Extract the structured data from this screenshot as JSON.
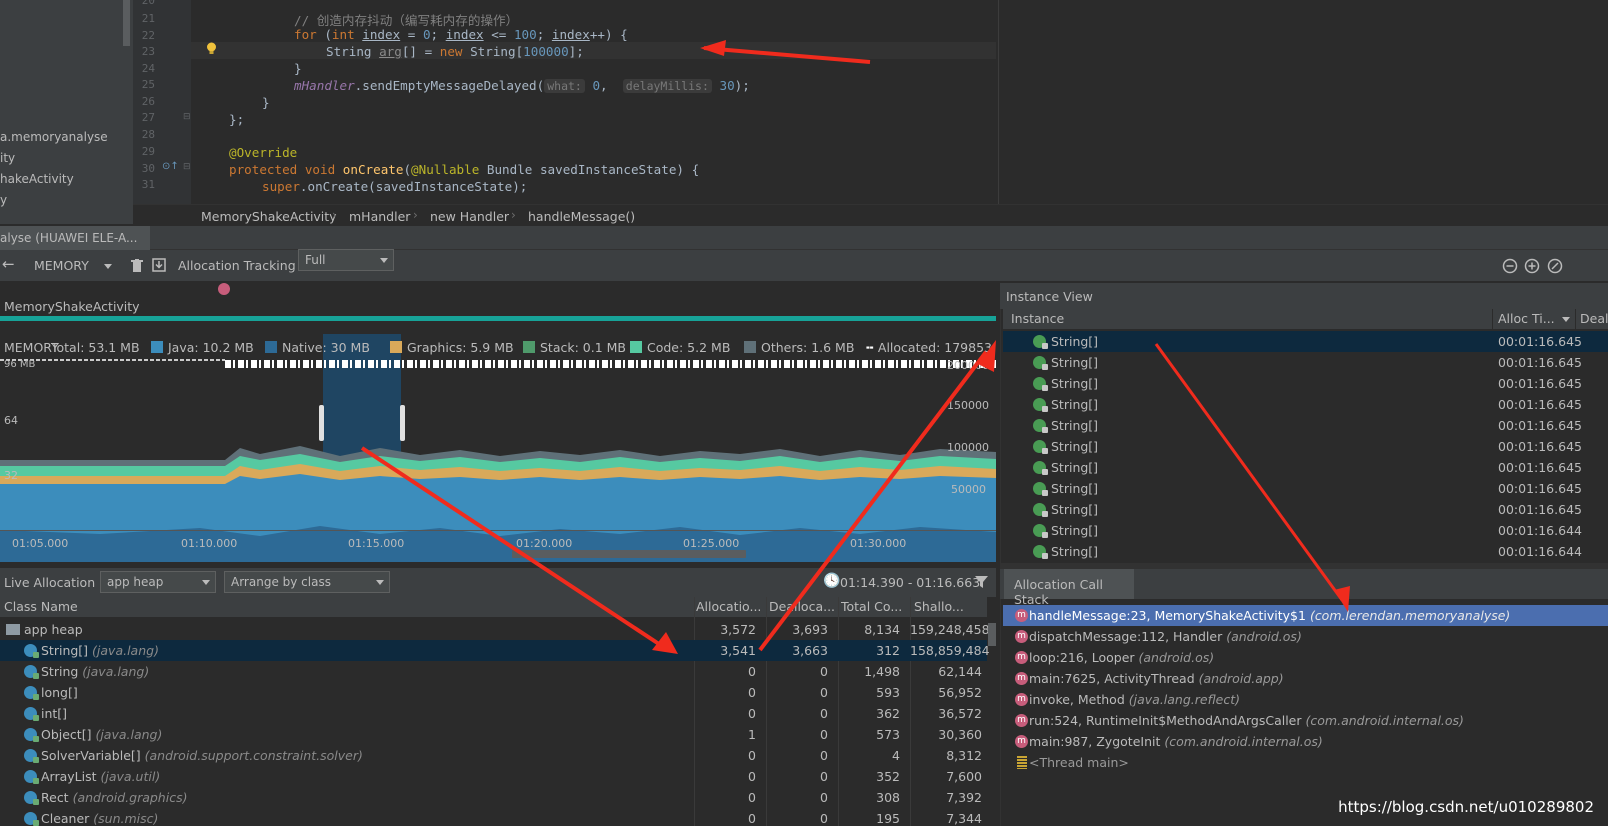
{
  "project_tree": {
    "items": [
      "a.memoryanalyse",
      "ity",
      "hakeActivity",
      "y"
    ]
  },
  "editor": {
    "line_numbers": [
      "20",
      "21",
      "22",
      "23",
      "24",
      "25",
      "26",
      "27",
      "28",
      "29",
      "30",
      "31"
    ],
    "comment_line": "// 创造内存抖动（编写耗内存的操作）",
    "for_kw": "for",
    "for_int": "int",
    "for_index": "index",
    "for_eq": " = ",
    "for_zero": "0",
    "for_cond_index": "index",
    "for_le": " <= ",
    "for_100": "100",
    "for_inc_index": "index",
    "for_tail": "++) {",
    "str_type": "String ",
    "str_var": "arg",
    "str_mid": "[] = ",
    "str_new": "new",
    "str_ctor": " String[",
    "str_size": "100000",
    "str_end": "];",
    "close_brace": "}",
    "handler_field": "mHandler",
    "handler_call": ".sendEmptyMessageDelayed(",
    "hint_what": "what:",
    "arg_what": "0",
    "hint_delay": "delayMillis:",
    "arg_delay": "30",
    "call_end": ");",
    "inner_close": "}",
    "outer_close": "};",
    "override": "@Override",
    "protected_kw": "protected",
    "void_kw": "void",
    "method_name": "onCreate",
    "nullable": "@Nullable",
    "param": " Bundle savedInstanceState) {",
    "super_kw": "super",
    "super_call": ".onCreate(savedInstanceState);"
  },
  "breadcrumb": [
    "MemoryShakeActivity",
    "mHandler",
    "new Handler",
    "handleMessage()"
  ],
  "tool_window": {
    "tab_label": "alyse (HUAWEI ELE-A..."
  },
  "profiler_bar": {
    "section": "MEMORY",
    "allocation_tracking_label": "Allocation Tracking",
    "allocation_tracking_value": "Full"
  },
  "timeline": {
    "activity_label": "MemoryShakeActivity",
    "legend": {
      "memory": "MEMORY",
      "total": "Total: 53.1 MB",
      "java": "Java: 10.2 MB",
      "native": "Native: 30 MB",
      "graphics": "Graphics: 5.9 MB",
      "stack": "Stack: 0.1 MB",
      "code": "Code: 5.2 MB",
      "others": "Others: 1.6 MB",
      "allocated": "Allocated: 179853"
    },
    "y_left": [
      "96 MB",
      "64",
      "32"
    ],
    "y_right": [
      "200000",
      "150000",
      "100000",
      "50000"
    ],
    "x_ticks": [
      "01:05.000",
      "01:10.000",
      "01:15.000",
      "01:20.000",
      "01:25.000",
      "01:30.000"
    ]
  },
  "colors": {
    "java": "#3c8dbc",
    "native": "#2d6a96",
    "graphics": "#d9a95a",
    "stack": "#4f9a6b",
    "code": "#56c9a1",
    "others": "#5f7078",
    "selection": "#1c4f75",
    "accent_bar": "#17a398"
  },
  "live_allocation": {
    "label": "Live Allocation",
    "heap": "app heap",
    "arrange": "Arrange by class",
    "range": "01:14.390 - 01:16.663"
  },
  "class_table": {
    "headers": [
      "Class Name",
      "Allocatio...",
      "Dealloca...",
      "Total Co...",
      "Shallo..."
    ],
    "rows": [
      {
        "name": "app heap",
        "pkg": "",
        "alloc": "3,572",
        "dealloc": "3,693",
        "total": "8,134",
        "shallow": "159,248,458"
      },
      {
        "name": "String[]",
        "pkg": "(java.lang)",
        "alloc": "3,541",
        "dealloc": "3,663",
        "total": "312",
        "shallow": "158,859,484"
      },
      {
        "name": "String",
        "pkg": "(java.lang)",
        "alloc": "0",
        "dealloc": "0",
        "total": "1,498",
        "shallow": "62,144"
      },
      {
        "name": "long[]",
        "pkg": "",
        "alloc": "0",
        "dealloc": "0",
        "total": "593",
        "shallow": "56,952"
      },
      {
        "name": "int[]",
        "pkg": "",
        "alloc": "0",
        "dealloc": "0",
        "total": "362",
        "shallow": "36,572"
      },
      {
        "name": "Object[]",
        "pkg": "(java.lang)",
        "alloc": "1",
        "dealloc": "0",
        "total": "573",
        "shallow": "30,360"
      },
      {
        "name": "SolverVariable[]",
        "pkg": "(android.support.constraint.solver)",
        "alloc": "0",
        "dealloc": "0",
        "total": "4",
        "shallow": "8,312"
      },
      {
        "name": "ArrayList",
        "pkg": "(java.util)",
        "alloc": "0",
        "dealloc": "0",
        "total": "352",
        "shallow": "7,600"
      },
      {
        "name": "Rect",
        "pkg": "(android.graphics)",
        "alloc": "0",
        "dealloc": "0",
        "total": "308",
        "shallow": "7,392"
      },
      {
        "name": "Cleaner",
        "pkg": "(sun.misc)",
        "alloc": "0",
        "dealloc": "0",
        "total": "195",
        "shallow": "7,344"
      }
    ]
  },
  "instance_view": {
    "title": "Instance View",
    "headers": [
      "Instance",
      "Alloc Ti...",
      "Deall"
    ],
    "rows": [
      {
        "name": "String[]",
        "time": "00:01:16.645"
      },
      {
        "name": "String[]",
        "time": "00:01:16.645"
      },
      {
        "name": "String[]",
        "time": "00:01:16.645"
      },
      {
        "name": "String[]",
        "time": "00:01:16.645"
      },
      {
        "name": "String[]",
        "time": "00:01:16.645"
      },
      {
        "name": "String[]",
        "time": "00:01:16.645"
      },
      {
        "name": "String[]",
        "time": "00:01:16.645"
      },
      {
        "name": "String[]",
        "time": "00:01:16.645"
      },
      {
        "name": "String[]",
        "time": "00:01:16.645"
      },
      {
        "name": "String[]",
        "time": "00:01:16.644"
      },
      {
        "name": "String[]",
        "time": "00:01:16.644"
      }
    ]
  },
  "call_stack": {
    "tab": "Allocation Call Stack",
    "frames": [
      {
        "method": "handleMessage:23, MemoryShakeActivity$1",
        "pkg": "(com.lerendan.memoryanalyse)"
      },
      {
        "method": "dispatchMessage:112, Handler",
        "pkg": "(android.os)"
      },
      {
        "method": "loop:216, Looper",
        "pkg": "(android.os)"
      },
      {
        "method": "main:7625, ActivityThread",
        "pkg": "(android.app)"
      },
      {
        "method": "invoke, Method",
        "pkg": "(java.lang.reflect)"
      },
      {
        "method": "run:524, RuntimeInit$MethodAndArgsCaller",
        "pkg": "(com.android.internal.os)"
      },
      {
        "method": "main:987, ZygoteInit",
        "pkg": "(com.android.internal.os)"
      }
    ],
    "thread": "<Thread main>"
  },
  "watermark": "https://blog.csdn.net/u010289802"
}
